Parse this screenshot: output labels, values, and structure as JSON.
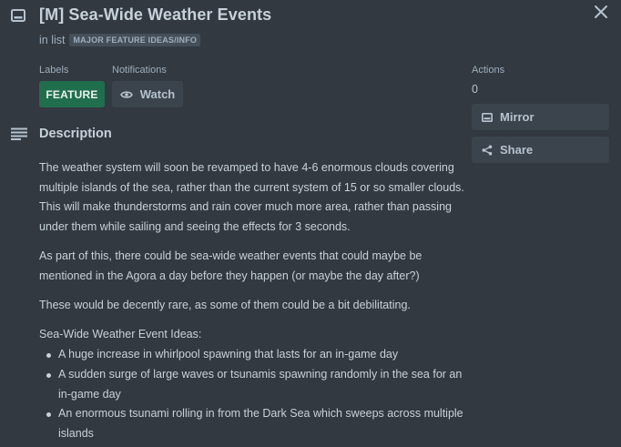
{
  "card": {
    "title": "[M] Sea-Wide Weather Events",
    "in_list_prefix": "in list",
    "list_name": "MAJOR FEATURE IDEAS/INFO"
  },
  "labels": {
    "heading": "Labels",
    "items": [
      {
        "text": "FEATURE",
        "color": "#216e4e"
      }
    ]
  },
  "notifications": {
    "heading": "Notifications",
    "watch_label": "Watch"
  },
  "actions": {
    "heading": "Actions",
    "count": "0",
    "mirror_label": "Mirror",
    "share_label": "Share"
  },
  "description": {
    "heading": "Description",
    "paragraphs": [
      "The weather system will soon be revamped to have 4-6 enormous clouds covering multiple islands of the sea, rather than the current system of 15 or so smaller clouds. This will make thunderstorms and rain cover much more area, rather than passing under them while sailing and seeing the effects for 3 seconds.",
      "As part of this, there could be sea-wide weather events that could maybe be mentioned in the Agora a day before they happen (or maybe the day after?)",
      "These would be decently rare, as some of them could be a bit debilitating."
    ],
    "ideas_heading": "Sea-Wide Weather Event Ideas:",
    "ideas": [
      "A huge increase in whirlpool spawning that lasts for an in-game day",
      "A sudden surge of large waves or tsunamis spawning randomly in the sea for an in-game day",
      "An enormous tsunami rolling in from the Dark Sea which sweeps across multiple islands"
    ]
  },
  "icons": {
    "card": "card-icon",
    "close": "close-icon",
    "watch": "eye-icon",
    "mirror": "mirror-icon",
    "share": "share-icon",
    "description": "description-lines-icon"
  },
  "colors": {
    "background": "#323940",
    "label_green": "#216e4e",
    "button_bg": "#3b444c",
    "text": "#c7d1db"
  }
}
